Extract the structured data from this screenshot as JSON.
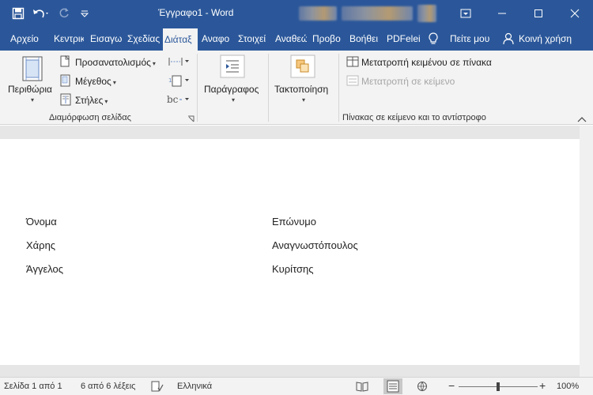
{
  "window": {
    "title": "Έγγραφο1  -  Word",
    "qat": {
      "save": "save-icon",
      "undo": "undo-icon",
      "redo": "redo-icon",
      "customize": "customize-qat-icon"
    },
    "controls": {
      "ribbon_options": "ribbon-display-options-icon",
      "minimize": "minimize-icon",
      "maximize": "maximize-icon",
      "close": "close-icon"
    }
  },
  "tabs": [
    {
      "label": "Αρχείο"
    },
    {
      "label": "Κεντρικ"
    },
    {
      "label": "Εισαγω"
    },
    {
      "label": "Σχεδίας"
    },
    {
      "label": "Διάταξ",
      "active": true
    },
    {
      "label": "Αναφο"
    },
    {
      "label": "Στοιχεί"
    },
    {
      "label": "Αναθεώ"
    },
    {
      "label": "Προβο"
    },
    {
      "label": "Βοήθει"
    },
    {
      "label": "PDFelei"
    }
  ],
  "tell_me": "Πείτε μου",
  "share": "Κοινή χρήση",
  "ribbon": {
    "page_setup": {
      "label": "Διαμόρφωση σελίδας",
      "margins": "Περιθώρια",
      "orientation": "Προσανατολισμός",
      "size": "Μέγεθος",
      "columns": "Στήλες"
    },
    "paragraph": {
      "label": "Παράγραφος"
    },
    "arrange": {
      "label": "Τακτοποίηση"
    },
    "convert": {
      "label": "Πίνακας σε κείμενο και το αντίστροφο",
      "text_to_table": "Μετατροπή κειμένου σε πίνακα",
      "table_to_text": "Μετατροπή σε κείμενο"
    }
  },
  "document": {
    "rows": [
      {
        "first": "Όνομα",
        "last": "Επώνυμο"
      },
      {
        "first": "Χάρης",
        "last": "Αναγνωστόπουλος"
      },
      {
        "first": "Άγγελος",
        "last": "Κυρίτσης"
      }
    ]
  },
  "status": {
    "page": "Σελίδα 1 από 1",
    "words": "6 από 6 λέξεις",
    "language": "Ελληνικά",
    "zoom": "100%",
    "zoom_fraction": 0.5
  },
  "colors": {
    "accent": "#2b579a",
    "ribbon": "#f3f3f3",
    "canvas": "#e6e6e6"
  }
}
